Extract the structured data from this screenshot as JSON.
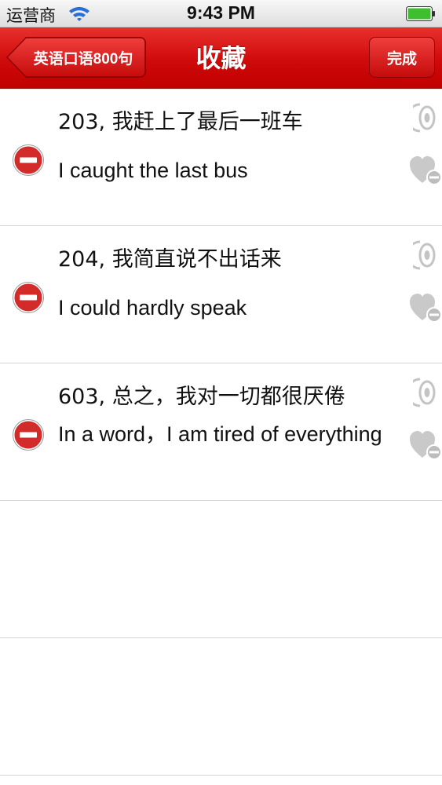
{
  "status_bar": {
    "carrier": "运营商",
    "time": "9:43 PM"
  },
  "nav": {
    "back_label": "英语口语800句",
    "title": "收藏",
    "done_label": "完成",
    "accent_color": "#cc0a0a"
  },
  "favorites": [
    {
      "cn": "203, 我赶上了最后一班车",
      "en": "I caught the last bus"
    },
    {
      "cn": "204, 我简直说不出话来",
      "en": "I could hardly speak"
    },
    {
      "cn": "603, 总之，我对一切都很厌倦",
      "en": "In a word，I am tired of everything"
    }
  ],
  "icons": {
    "delete": "delete-icon",
    "speaker": "speaker-icon",
    "unfavorite": "heart-minus-icon"
  }
}
